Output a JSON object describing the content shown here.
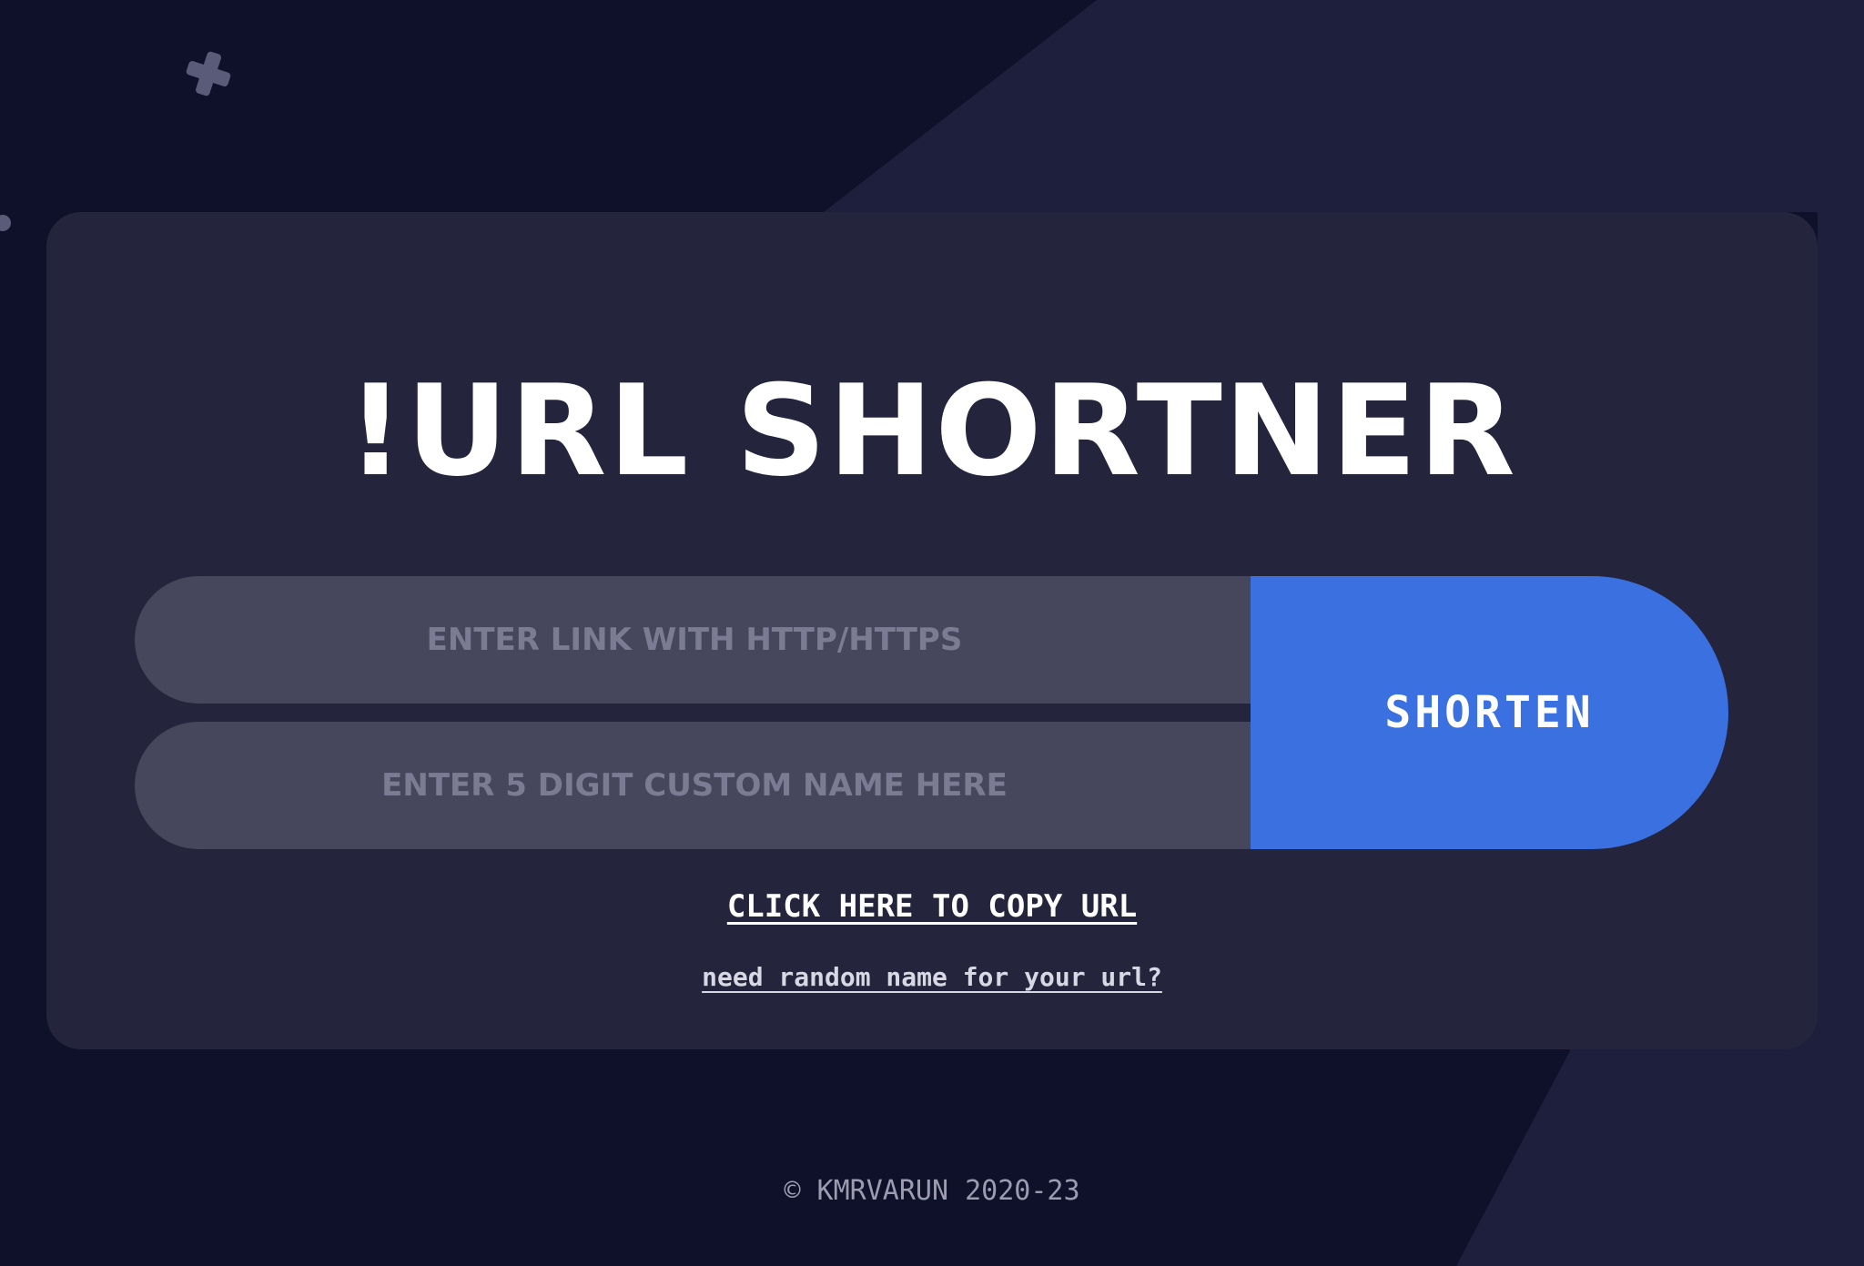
{
  "page": {
    "title": "!URL SHORTNER"
  },
  "form": {
    "link_placeholder": "ENTER LINK WITH HTTP/HTTPS",
    "custom_name_placeholder": "ENTER 5 DIGIT CUSTOM NAME HERE",
    "link_value": "",
    "custom_name_value": "",
    "submit_label": "SHORTEN"
  },
  "actions": {
    "copy_label": "CLICK HERE TO COPY URL",
    "random_name_label": "need random name for your url?"
  },
  "footer": {
    "copyright": "© KMRVARUN 2020-23"
  },
  "colors": {
    "background": "#0f1029",
    "card": "#24253d",
    "input": "#46475d",
    "placeholder": "#7b7c93",
    "accent": "#3b70e1",
    "text": "#ffffff"
  },
  "icons": {
    "decoration_plus": "plus-icon",
    "decoration_dot": "dot-icon"
  }
}
